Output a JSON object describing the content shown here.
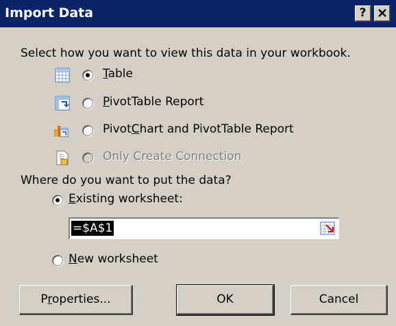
{
  "dialog": {
    "title": "Import Data",
    "help_button": "?",
    "close_button": "X"
  },
  "view_section": {
    "prompt": "Select how you want to view this data in your workbook.",
    "options": [
      {
        "label_pre": "",
        "mnemonic": "T",
        "label_post": "able",
        "selected": true,
        "enabled": true,
        "icon": "table-icon"
      },
      {
        "label_pre": "",
        "mnemonic": "P",
        "label_post": "ivotTable Report",
        "selected": false,
        "enabled": true,
        "icon": "pivottable-icon"
      },
      {
        "label_pre": "Pivot",
        "mnemonic": "C",
        "label_post": "hart and PivotTable Report",
        "selected": false,
        "enabled": true,
        "icon": "pivotchart-icon"
      },
      {
        "label_pre": "Only Create Connection",
        "mnemonic": "",
        "label_post": "",
        "selected": false,
        "enabled": false,
        "icon": "connection-icon"
      }
    ]
  },
  "destination_section": {
    "prompt": "Where do you want to put the data?",
    "existing": {
      "label_pre": "",
      "mnemonic": "E",
      "label_post": "xisting worksheet:",
      "selected": true
    },
    "cell_reference": "=$A$1",
    "new": {
      "label_pre": "",
      "mnemonic": "N",
      "label_post": "ew worksheet",
      "selected": false
    }
  },
  "buttons": {
    "properties_pre": "P",
    "properties_mnemonic": "r",
    "properties_post": "operties...",
    "ok": "OK",
    "cancel": "Cancel"
  }
}
